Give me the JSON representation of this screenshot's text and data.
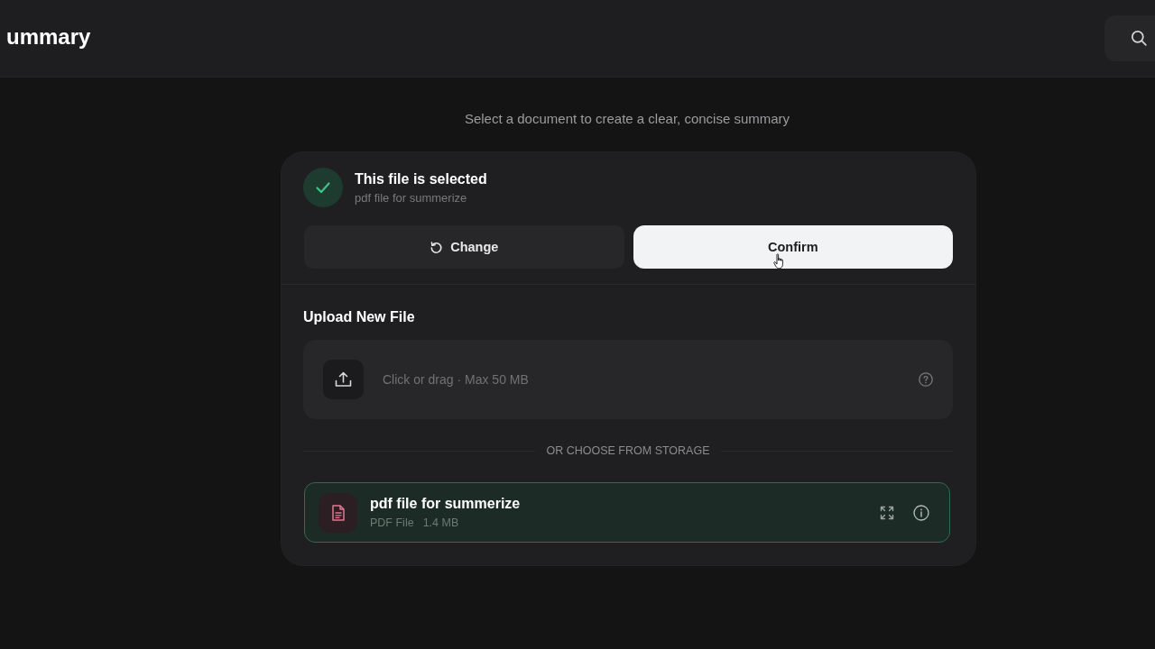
{
  "header": {
    "title": "ummary"
  },
  "subtitle": "Select a document to create a clear, concise summary",
  "selection": {
    "title": "This file is selected",
    "file_name": "pdf file for summerize",
    "buttons": [
      {
        "label": "Change",
        "kind": "secondary"
      },
      {
        "label": "Confirm",
        "kind": "primary"
      }
    ]
  },
  "upload": {
    "heading": "Upload New File",
    "hint": "Click or drag · Max 50 MB"
  },
  "storage": {
    "divider_label": "OR CHOOSE FROM STORAGE",
    "files": [
      {
        "name": "pdf file for summerize",
        "type": "PDF File",
        "size": "1.4 MB",
        "selected": true
      }
    ]
  }
}
